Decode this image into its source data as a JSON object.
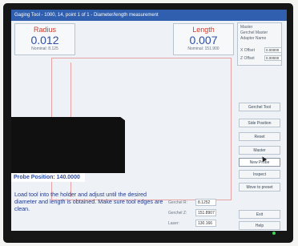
{
  "window": {
    "title": "Gaging Tool - 1000, 14, point 1 of 1 - Diameter/length measurement"
  },
  "readouts": {
    "radius": {
      "label": "Radius",
      "value": "0.012",
      "nominal": "Nominal: 8.125"
    },
    "length": {
      "label": "Length",
      "value": "0.007",
      "nominal": "Nominal: 151.900"
    }
  },
  "probe_position": "Probe Position: 140.0000",
  "instructions": "Load tool into the holder and adjust until the desired diameter and length is obtained.  Make sure tool edges are clean.",
  "status": [
    {
      "label": "Gerchel R:",
      "value": "8.1252"
    },
    {
      "label": "Gerchel Z:",
      "value": "151.8907"
    },
    {
      "label": "Laser:",
      "value": "130.166"
    }
  ],
  "side_panel": {
    "header": "Master",
    "line1": "Gerchel Master",
    "line2": "Adapter Name",
    "x_offset_label": "X Offset",
    "x_offset_value": "0.00000",
    "z_offset_label": "Z Offset",
    "z_offset_value": "0.00000"
  },
  "buttons": [
    {
      "label": "Gerchel Tool"
    },
    {
      "label": "Side Position"
    },
    {
      "label": "Reset"
    },
    {
      "label": "Master"
    },
    {
      "label": "New Probe"
    },
    {
      "label": "Inspect"
    },
    {
      "label": "Move to preset"
    },
    {
      "label": "Exit"
    },
    {
      "label": "Help"
    }
  ],
  "colors": {
    "title_bar": "#2f5fae",
    "readout_label": "#d23a2c",
    "readout_value": "#2f4fa8",
    "frame_lines": "#e7a3a3"
  },
  "icons": {
    "pointer": "mouse-cursor-icon",
    "power": "power-led-icon"
  }
}
